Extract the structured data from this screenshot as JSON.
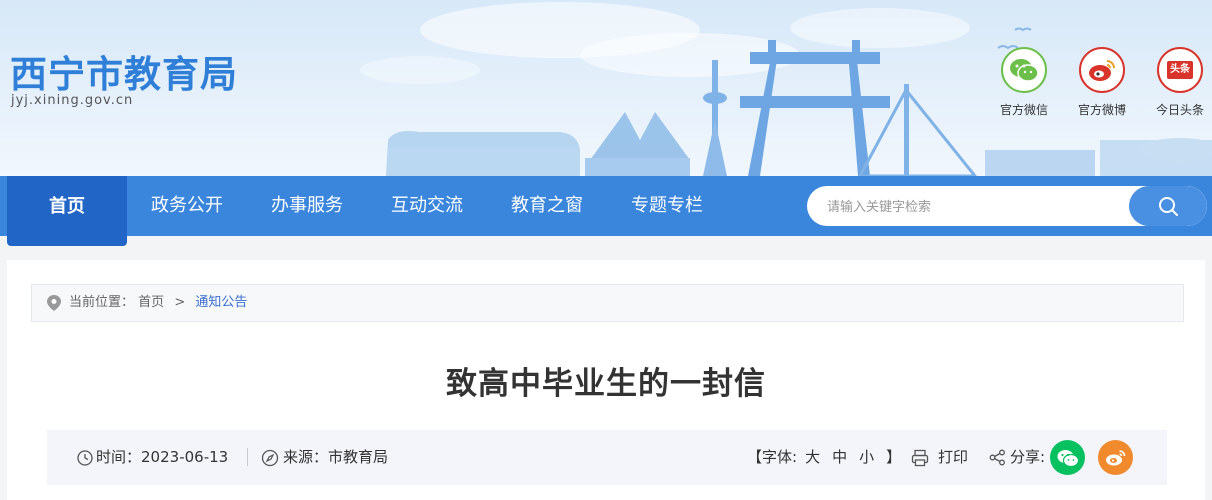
{
  "site": {
    "title": "西宁市教育局",
    "domain": "jyj.xining.gov.cn"
  },
  "social": [
    {
      "label": "官方微信",
      "icon": "wechat-icon",
      "color": "#6cc04a"
    },
    {
      "label": "官方微博",
      "icon": "weibo-icon",
      "color": "#d9342b"
    },
    {
      "label": "今日头条",
      "icon": "toutiao-icon",
      "color": "#d9342b",
      "badge": "头条"
    }
  ],
  "nav": {
    "items": [
      "首页",
      "政务公开",
      "办事服务",
      "互动交流",
      "教育之窗",
      "专题专栏"
    ],
    "active": "首页",
    "search_placeholder": "请输入关键字检索"
  },
  "breadcrumb": {
    "prefix": "当前位置：",
    "home": "首页",
    "separator": ">",
    "current": "通知公告"
  },
  "article": {
    "title": "致高中毕业生的一封信",
    "time_label": "时间：",
    "date": "2023-06-13",
    "source_label": "来源：",
    "source": "市教育局",
    "font_open": "【字体:",
    "font_large": "大",
    "font_medium": "中",
    "font_small": "小",
    "font_close": "】",
    "print_label": "打印",
    "share_label": "分享:"
  },
  "colors": {
    "nav_bg": "#3a86dc",
    "nav_active": "#2166c6",
    "brand_blue": "#2f7fd8",
    "wechat_green": "#07c160",
    "weibo_orange": "#f08a2c"
  }
}
